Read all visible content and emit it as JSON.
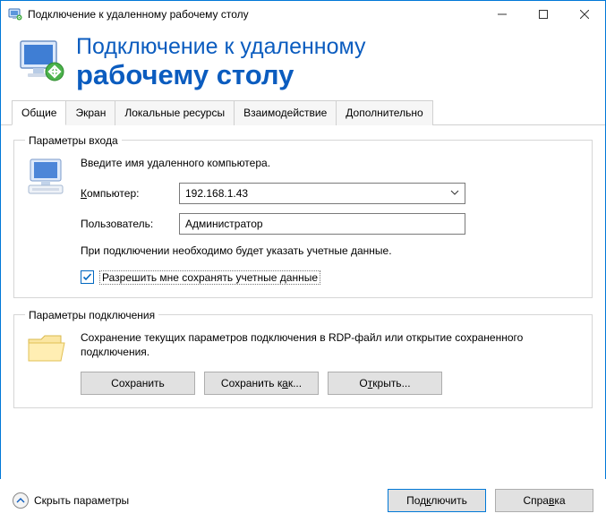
{
  "window": {
    "title": "Подключение к удаленному рабочему столу"
  },
  "header": {
    "line1": "Подключение к удаленному",
    "line2": "рабочему столу"
  },
  "tabs": {
    "general": "Общие",
    "display": "Экран",
    "local": "Локальные ресурсы",
    "experience": "Взаимодействие",
    "advanced": "Дополнительно"
  },
  "login_group": {
    "legend": "Параметры входа",
    "intro": "Введите имя удаленного компьютера.",
    "computer_label_pre": "К",
    "computer_label_rest": "омпьютер:",
    "computer_value": "192.168.1.43",
    "user_label": "Пользователь:",
    "user_value": "Администратор",
    "note": "При подключении необходимо будет указать учетные данные.",
    "checkbox_label": "Разрешить мне сохранять учетные данные"
  },
  "conn_group": {
    "legend": "Параметры подключения",
    "desc": "Сохранение текущих параметров подключения в RDP-файл или открытие сохраненного подключения.",
    "save": "Сохранить",
    "saveas_pre": "Сохранить к",
    "saveas_u": "а",
    "saveas_post": "к...",
    "open_pre": "О",
    "open_u": "т",
    "open_post": "крыть..."
  },
  "footer": {
    "hide_pre": "Скрыть ",
    "hide_u": "п",
    "hide_post": "араметры",
    "connect_pre": "Под",
    "connect_u": "к",
    "connect_post": "лючить",
    "help_pre": "Спра",
    "help_u": "в",
    "help_post": "ка"
  }
}
